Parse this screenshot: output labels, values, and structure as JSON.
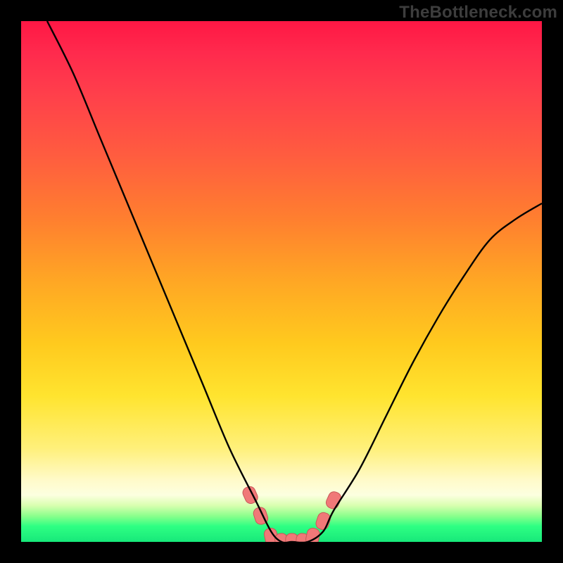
{
  "watermark": {
    "text": "TheBottleneck.com"
  },
  "colors": {
    "curve_stroke": "#000000",
    "marker_fill": "#f07878",
    "marker_stroke": "#c85858",
    "gradient_top": "#ff1744",
    "gradient_bottom": "#17e87a",
    "page_bg": "#000000"
  },
  "chart_data": {
    "type": "line",
    "title": "",
    "xlabel": "",
    "ylabel": "",
    "xlim": [
      0,
      100
    ],
    "ylim": [
      0,
      100
    ],
    "note": "y is bottleneck percentage; 0 near bottom (green), 100 at top (red). x is an unlabeled horizontal scale. Minimum (~0%) lies around x≈48–58. Marker cluster highlights the valley floor.",
    "series": [
      {
        "name": "bottleneck-curve",
        "x": [
          5,
          10,
          15,
          20,
          25,
          30,
          35,
          40,
          45,
          48,
          50,
          52,
          55,
          58,
          60,
          65,
          70,
          75,
          80,
          85,
          90,
          95,
          100
        ],
        "y": [
          100,
          90,
          78,
          66,
          54,
          42,
          30,
          18,
          8,
          2,
          0,
          0,
          0,
          2,
          6,
          14,
          24,
          34,
          43,
          51,
          58,
          62,
          65
        ]
      }
    ],
    "markers": {
      "name": "valley-markers",
      "points": [
        {
          "x": 44,
          "y": 9
        },
        {
          "x": 46,
          "y": 5
        },
        {
          "x": 48,
          "y": 1
        },
        {
          "x": 50,
          "y": 0
        },
        {
          "x": 52,
          "y": 0
        },
        {
          "x": 54,
          "y": 0
        },
        {
          "x": 56,
          "y": 1
        },
        {
          "x": 58,
          "y": 4
        },
        {
          "x": 60,
          "y": 8
        }
      ]
    }
  }
}
